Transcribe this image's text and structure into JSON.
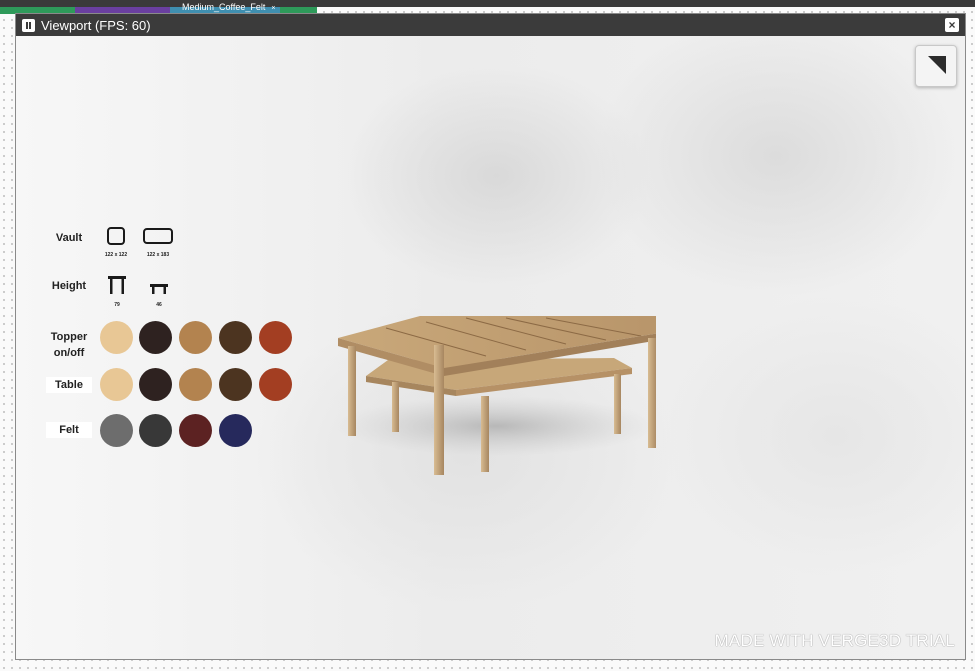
{
  "editor": {
    "tab_label": "Medium_Coffee_Felt",
    "tab_close": "×",
    "tab_colors": [
      "#2e9a5a",
      "#6a3fa0",
      "#3f8fb0",
      "#2e9a5a"
    ]
  },
  "window": {
    "title": "Viewport (FPS: 60)",
    "close_label": "×"
  },
  "configurator": {
    "vault": {
      "label": "Vault",
      "options": [
        {
          "caption": "122 x 122",
          "icon": "square-table-icon"
        },
        {
          "caption": "122 x 183",
          "icon": "rectangle-table-icon"
        }
      ]
    },
    "height": {
      "label": "Height",
      "options": [
        {
          "caption": "79",
          "icon": "tall-table-icon"
        },
        {
          "caption": "46",
          "icon": "low-table-icon"
        }
      ]
    },
    "topper": {
      "label_line1": "Topper",
      "label_line2": "on/off",
      "colors": [
        "#e8c795",
        "#2e2220",
        "#b3834f",
        "#4c3420",
        "#a33e22"
      ]
    },
    "table": {
      "label": "Table",
      "colors": [
        "#e8c795",
        "#2e2220",
        "#b3834f",
        "#4c3420",
        "#a33e22"
      ]
    },
    "felt": {
      "label": "Felt",
      "colors": [
        "#6d6d6d",
        "#383838",
        "#5c2222",
        "#26295c"
      ]
    }
  },
  "watermark": "MADE WITH VERGE3D TRIAL"
}
